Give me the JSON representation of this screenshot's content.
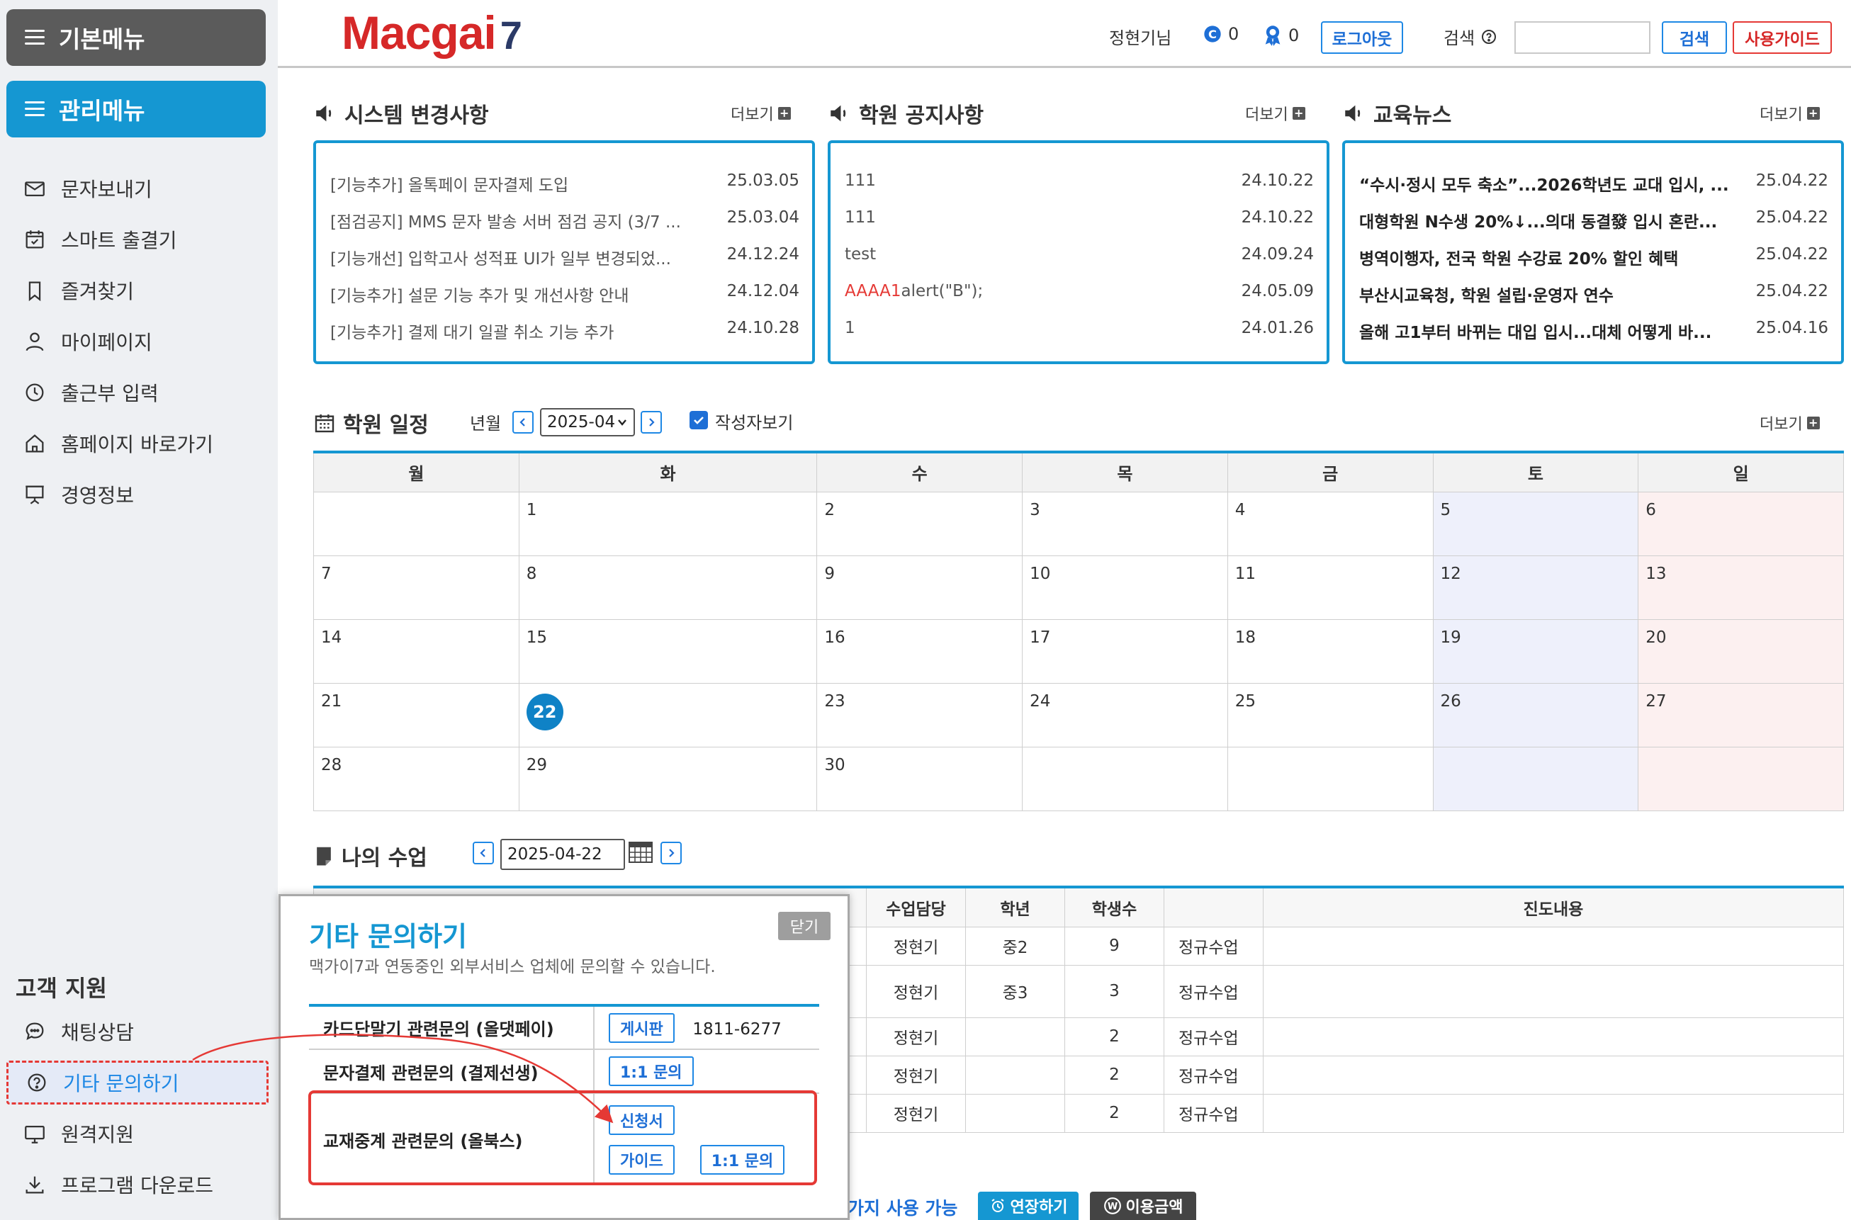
{
  "sidebar": {
    "basic_menu": "기본메뉴",
    "admin_menu": "관리메뉴",
    "items": [
      {
        "label": "문자보내기",
        "icon": "envelope-icon"
      },
      {
        "label": "스마트 출결기",
        "icon": "calendar-check-icon"
      },
      {
        "label": "즐겨찾기",
        "icon": "bookmark-icon"
      },
      {
        "label": "마이페이지",
        "icon": "user-icon"
      },
      {
        "label": "출근부 입력",
        "icon": "clock-icon"
      },
      {
        "label": "홈페이지 바로가기",
        "icon": "home-icon"
      },
      {
        "label": "경영정보",
        "icon": "presentation-icon"
      }
    ],
    "support_title": "고객 지원",
    "support_items": [
      {
        "label": "채팅상담",
        "icon": "chat-icon"
      },
      {
        "label": "기타 문의하기",
        "icon": "question-circle-icon"
      },
      {
        "label": "원격지원",
        "icon": "monitor-icon"
      },
      {
        "label": "프로그램 다운로드",
        "icon": "download-icon"
      }
    ]
  },
  "header": {
    "logo_text": "Macgai",
    "logo_num": "7",
    "user_name": "정현기님",
    "count_a": "0",
    "count_b": "0",
    "logout": "로그아웃",
    "search_label": "검색",
    "search_value": "",
    "search_button": "검색",
    "guide_button": "사용가이드"
  },
  "panels": {
    "more_label": "더보기",
    "system": {
      "title": "시스템 변경사항",
      "rows": [
        {
          "title": "[기능추가] 올톡페이 문자결제 도입",
          "date": "25.03.05"
        },
        {
          "title": "[점검공지] MMS 문자 발송 서버 점검 공지 (3/7 ...",
          "date": "25.03.04"
        },
        {
          "title": "[기능개선] 입학고사 성적표 UI가 일부 변경되었...",
          "date": "24.12.24"
        },
        {
          "title": "[기능추가] 설문 기능 추가 및 개선사항 안내",
          "date": "24.12.04"
        },
        {
          "title": "[기능추가] 결제 대기 일괄 취소 기능 추가",
          "date": "24.10.28"
        }
      ]
    },
    "notice": {
      "title": "학원 공지사항",
      "rows": [
        {
          "title": "111",
          "date": "24.10.22"
        },
        {
          "title": "111",
          "date": "24.10.22"
        },
        {
          "title": "test",
          "date": "24.09.24"
        },
        {
          "title_red": "AAAA1",
          "title": "alert(\"B\");",
          "date": "24.05.09"
        },
        {
          "title": "1",
          "date": "24.01.26"
        }
      ]
    },
    "news": {
      "title": "교육뉴스",
      "rows": [
        {
          "title": "“수시·정시 모두 축소”...2026학년도 교대 입시, ...",
          "date": "25.04.22"
        },
        {
          "title": "대형학원 N수생 20%↓...의대 동결發 입시 혼란...",
          "date": "25.04.22"
        },
        {
          "title": "병역이행자, 전국 학원 수강료 20% 할인 혜택",
          "date": "25.04.22"
        },
        {
          "title": "부산시교육청, 학원 설립·운영자 연수",
          "date": "25.04.22"
        },
        {
          "title": "올해 고1부터 바뀌는 대입 입시...대체 어떻게 바...",
          "date": "25.04.16"
        }
      ]
    }
  },
  "schedule": {
    "title": "학원 일정",
    "nav_label": "년월",
    "month": "2025-04",
    "writer_label": "작성자보기",
    "weekdays": [
      "월",
      "화",
      "수",
      "목",
      "금",
      "토",
      "일"
    ],
    "weeks": [
      [
        "",
        "1",
        "2",
        "3",
        "4",
        "5",
        "6"
      ],
      [
        "7",
        "8",
        "9",
        "10",
        "11",
        "12",
        "13"
      ],
      [
        "14",
        "15",
        "16",
        "17",
        "18",
        "19",
        "20"
      ],
      [
        "21",
        "22",
        "23",
        "24",
        "25",
        "26",
        "27"
      ],
      [
        "28",
        "29",
        "30",
        "",
        "",
        "",
        ""
      ]
    ],
    "today": "22"
  },
  "my_class": {
    "title": "나의 수업",
    "date": "2025-04-22",
    "headers": [
      "수업담당",
      "학년",
      "학생수",
      "",
      "진도내용"
    ],
    "rows": [
      {
        "teacher": "정현기",
        "grade": "중2",
        "count": "9",
        "type": "정규수업",
        "progress": ""
      },
      {
        "teacher": "정현기",
        "grade": "중3",
        "count": "3",
        "type": "정규수업",
        "progress": ""
      },
      {
        "teacher": "정현기",
        "grade": "",
        "count": "2",
        "type": "정규수업",
        "progress": ""
      },
      {
        "teacher": "정현기",
        "grade": "",
        "count": "2",
        "type": "정규수업",
        "progress": ""
      },
      {
        "teacher": "정현기",
        "grade": "",
        "count": "2",
        "type": "정규수업",
        "progress": ""
      }
    ]
  },
  "bottom_bar": {
    "text": "가지 사용 가능",
    "extend": "연장하기",
    "usage": "이용금액"
  },
  "popup": {
    "title": "기타 문의하기",
    "desc": "맥가이7과 연동중인 외부서비스 업체에 문의할 수 있습니다.",
    "close": "닫기",
    "rows": [
      {
        "label": "카드단말기 관련문의 (올댓페이)",
        "btn": "게시판",
        "phone": "1811-6277"
      },
      {
        "label": "문자결제 관련문의 (결제선생)",
        "btn": "1:1 문의"
      },
      {
        "label": "교재중계 관련문의 (올북스)",
        "btn_apply": "신청서",
        "btn_guide": "가이드",
        "btn_inquiry": "1:1 문의"
      }
    ]
  },
  "colors": {
    "accent": "#1597d2",
    "brand_red": "#d62828",
    "highlight": "#e53935"
  }
}
